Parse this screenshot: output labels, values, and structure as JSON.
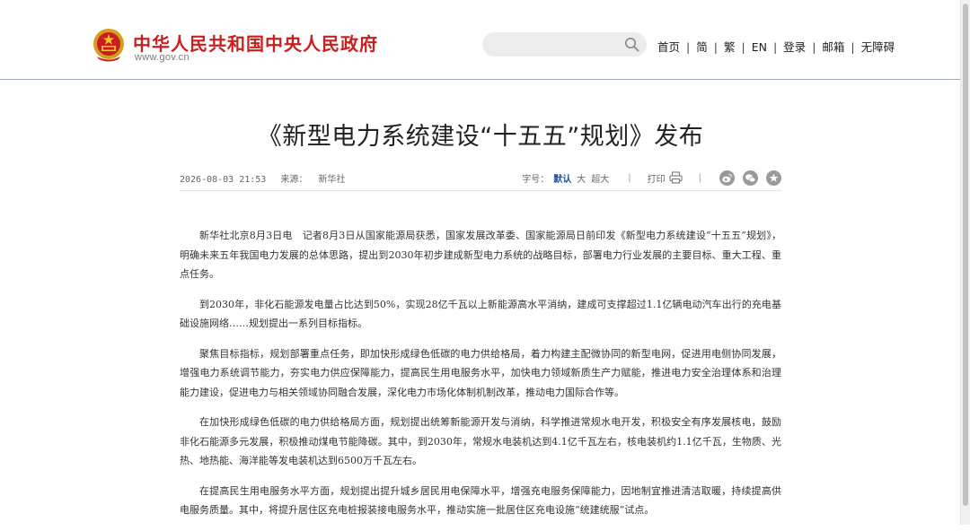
{
  "header": {
    "site_name": "中华人民共和国中央人民政府",
    "site_domain": "www.gov.cn",
    "search_placeholder": "",
    "nav": [
      "首页",
      "简",
      "繁",
      "EN",
      "登录",
      "邮箱",
      "无障碍"
    ]
  },
  "article": {
    "title": "《新型电力系统建设“十五五”规划》发布",
    "date": "2026-08-03 21:53",
    "source_label": "来源：",
    "source": "新华社",
    "font_size_label": "字号：",
    "font_sizes": [
      "默认",
      "大",
      "超大"
    ],
    "active_font_size": "默认",
    "print_label": "打印",
    "share_icons": [
      "weibo-icon",
      "wechat-icon",
      "favorite-icon"
    ],
    "paragraphs": [
      "新华社北京8月3日电　记者8月3日从国家能源局获悉，国家发展改革委、国家能源局日前印发《新型电力系统建设“十五五”规划》，明确未来五年我国电力发展的总体思路，提出到2030年初步建成新型电力系统的战略目标，部署电力行业发展的主要目标、重大工程、重点任务。",
      "到2030年，非化石能源发电量占比达到50%，实现28亿千瓦以上新能源高水平消纳，建成可支撑超过1.1亿辆电动汽车出行的充电基础设施网络……规划提出一系列目标指标。",
      "聚焦目标指标，规划部署重点任务，即加快形成绿色低碳的电力供给格局，着力构建主配微协同的新型电网，促进用电侧协同发展，增强电力系统调节能力，夯实电力供应保障能力，提高民生用电服务水平，加快电力领域新质生产力赋能，推进电力安全治理体系和治理能力建设，促进电力与相关领域协同融合发展，深化电力市场化体制机制改革，推动电力国际合作等。",
      "在加快形成绿色低碳的电力供给格局方面，规划提出统筹新能源开发与消纳，科学推进常规水电开发，积极安全有序发展核电，鼓励非化石能源多元发展，积极推动煤电节能降碳。其中，到2030年，常规水电装机达到4.1亿千瓦左右，核电装机约1.1亿千瓦，生物质、光热、地热能、海洋能等发电装机达到6500万千瓦左右。",
      "在提高民生用电服务水平方面，规划提出提升城乡居民用电保障水平，增强充电服务保障能力，因地制宜推进清洁取暖，持续提高供电服务质量。其中，将提升居住区充电桩报装接电服务水平，推动实施一批居住区充电设施“统建统服”试点。"
    ]
  },
  "colors": {
    "brand_red": "#c9201f",
    "link_blue": "#1c4f9c",
    "header_border": "#9aa7b4"
  }
}
